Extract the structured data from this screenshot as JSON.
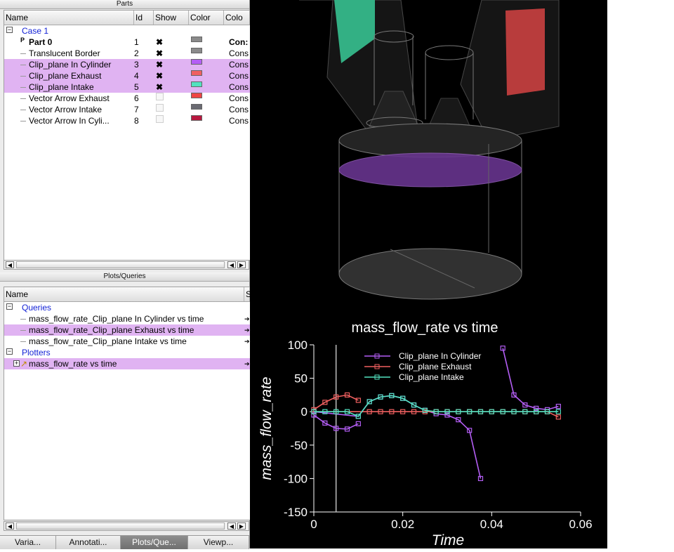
{
  "parts_panel": {
    "title": "Parts",
    "columns": [
      "Name",
      "Id",
      "Show",
      "Color",
      "Colo"
    ],
    "rows": [
      {
        "name": "Case 1",
        "id": "",
        "show": "",
        "color": "",
        "colo": "",
        "level": 0,
        "kind": "case"
      },
      {
        "name": "Part 0",
        "id": "1",
        "show": "x",
        "color": "#8a8a8a",
        "colo": "Con:",
        "level": 1,
        "kind": "part",
        "bold": true,
        "prefix": "P"
      },
      {
        "name": "Translucent Border",
        "id": "2",
        "show": "x",
        "color": "#8a8a8a",
        "colo": "Cons",
        "level": 1,
        "kind": "part"
      },
      {
        "name": "Clip_plane In Cylinder",
        "id": "3",
        "show": "x",
        "color": "#b45ef5",
        "colo": "Cons",
        "level": 1,
        "kind": "part",
        "selected": true
      },
      {
        "name": "Clip_plane Exhaust",
        "id": "4",
        "show": "x",
        "color": "#f06060",
        "colo": "Cons",
        "level": 1,
        "kind": "part",
        "selected": true
      },
      {
        "name": "Clip_plane Intake",
        "id": "5",
        "show": "x",
        "color": "#52e2c0",
        "colo": "Cons",
        "level": 1,
        "kind": "part",
        "selected": true
      },
      {
        "name": "Vector Arrow Exhaust",
        "id": "6",
        "show": "",
        "color": "#ee4444",
        "colo": "Cons",
        "level": 1,
        "kind": "part"
      },
      {
        "name": "Vector Arrow Intake",
        "id": "7",
        "show": "",
        "color": "#6a6a72",
        "colo": "Cons",
        "level": 1,
        "kind": "part"
      },
      {
        "name": "Vector Arrow In Cyli...",
        "id": "8",
        "show": "",
        "color": "#b8183f",
        "colo": "Cons",
        "level": 1,
        "kind": "part"
      }
    ]
  },
  "plots_panel": {
    "title": "Plots/Queries",
    "columns": [
      "Name",
      "S"
    ],
    "rows": [
      {
        "name": "Queries",
        "kind": "group",
        "mark": ""
      },
      {
        "name": "mass_flow_rate_Clip_plane In Cylinder vs time",
        "kind": "query",
        "mark": "➔"
      },
      {
        "name": "mass_flow_rate_Clip_plane Exhaust vs time",
        "kind": "query",
        "selected": true,
        "mark": "➔"
      },
      {
        "name": "mass_flow_rate_Clip_plane Intake vs time",
        "kind": "query",
        "mark": "➔"
      },
      {
        "name": "Plotters",
        "kind": "group",
        "mark": ""
      },
      {
        "name": "mass_flow_rate vs time",
        "kind": "plotter",
        "selected": true,
        "mark": "➔"
      }
    ]
  },
  "tabs": [
    {
      "label": "Varia..."
    },
    {
      "label": "Annotati..."
    },
    {
      "label": "Plots/Que...",
      "active": true
    },
    {
      "label": "Viewp..."
    }
  ],
  "colors": {
    "cylinder": "#b45ef5",
    "exhaust": "#f06060",
    "intake": "#52e2c0"
  },
  "chart_data": {
    "type": "line",
    "title": "mass_flow_rate vs time",
    "xlabel": "Time",
    "ylabel": "mass_flow_rate",
    "xlim": [
      0,
      0.06
    ],
    "ylim": [
      -150,
      100
    ],
    "xticks": [
      "0",
      "0.02",
      "0.04",
      "0.06"
    ],
    "yticks": [
      "100",
      "50",
      "0",
      "-50",
      "-100",
      "-150"
    ],
    "marker_line_x": 0.005,
    "legend_position": "top-center",
    "series": [
      {
        "name": "Clip_plane In Cylinder",
        "color": "#b45ef5",
        "segments": [
          [
            [
              0.0,
              -5
            ],
            [
              0.0025,
              -17
            ],
            [
              0.005,
              -25
            ],
            [
              0.0075,
              -26
            ],
            [
              0.01,
              -18
            ]
          ],
          [
            [
              0.0,
              0
            ],
            [
              0.01,
              -7
            ],
            [
              0.0125,
              15
            ],
            [
              0.015,
              22
            ],
            [
              0.0175,
              24
            ],
            [
              0.02,
              20
            ],
            [
              0.0225,
              10
            ],
            [
              0.025,
              2
            ],
            [
              0.0275,
              -3
            ],
            [
              0.03,
              -5
            ],
            [
              0.0325,
              -12
            ],
            [
              0.035,
              -28
            ],
            [
              0.0375,
              -100
            ]
          ],
          [
            [
              0.0425,
              95
            ],
            [
              0.045,
              25
            ],
            [
              0.0475,
              10
            ],
            [
              0.05,
              5
            ],
            [
              0.0525,
              3
            ],
            [
              0.055,
              8
            ]
          ]
        ]
      },
      {
        "name": "Clip_plane Exhaust",
        "color": "#f06060",
        "segments": [
          [
            [
              0.0,
              3
            ],
            [
              0.0025,
              14
            ],
            [
              0.005,
              22
            ],
            [
              0.0075,
              25
            ],
            [
              0.01,
              17
            ]
          ],
          [
            [
              0.0,
              0
            ],
            [
              0.0125,
              0
            ],
            [
              0.015,
              0
            ],
            [
              0.0175,
              0
            ],
            [
              0.02,
              0
            ],
            [
              0.0225,
              0
            ],
            [
              0.025,
              0
            ],
            [
              0.0275,
              0
            ],
            [
              0.03,
              0
            ],
            [
              0.0325,
              0
            ],
            [
              0.035,
              0
            ],
            [
              0.0375,
              0
            ],
            [
              0.04,
              0
            ],
            [
              0.0425,
              0
            ],
            [
              0.045,
              0
            ],
            [
              0.0475,
              0
            ],
            [
              0.05,
              0
            ],
            [
              0.0525,
              0
            ],
            [
              0.055,
              -8
            ]
          ]
        ]
      },
      {
        "name": "Clip_plane Intake",
        "color": "#52e2c0",
        "segments": [
          [
            [
              0.0,
              0
            ],
            [
              0.0025,
              0
            ],
            [
              0.005,
              0
            ],
            [
              0.0075,
              0
            ],
            [
              0.01,
              -7
            ],
            [
              0.0125,
              15
            ],
            [
              0.015,
              22
            ],
            [
              0.0175,
              24
            ],
            [
              0.02,
              20
            ],
            [
              0.0225,
              10
            ],
            [
              0.025,
              2
            ],
            [
              0.0275,
              0
            ],
            [
              0.03,
              0
            ],
            [
              0.0325,
              0
            ],
            [
              0.035,
              0
            ],
            [
              0.0375,
              0
            ],
            [
              0.04,
              0
            ],
            [
              0.0425,
              0
            ],
            [
              0.045,
              0
            ],
            [
              0.0475,
              0
            ],
            [
              0.05,
              0
            ],
            [
              0.0525,
              0
            ],
            [
              0.055,
              0
            ]
          ]
        ]
      }
    ]
  }
}
